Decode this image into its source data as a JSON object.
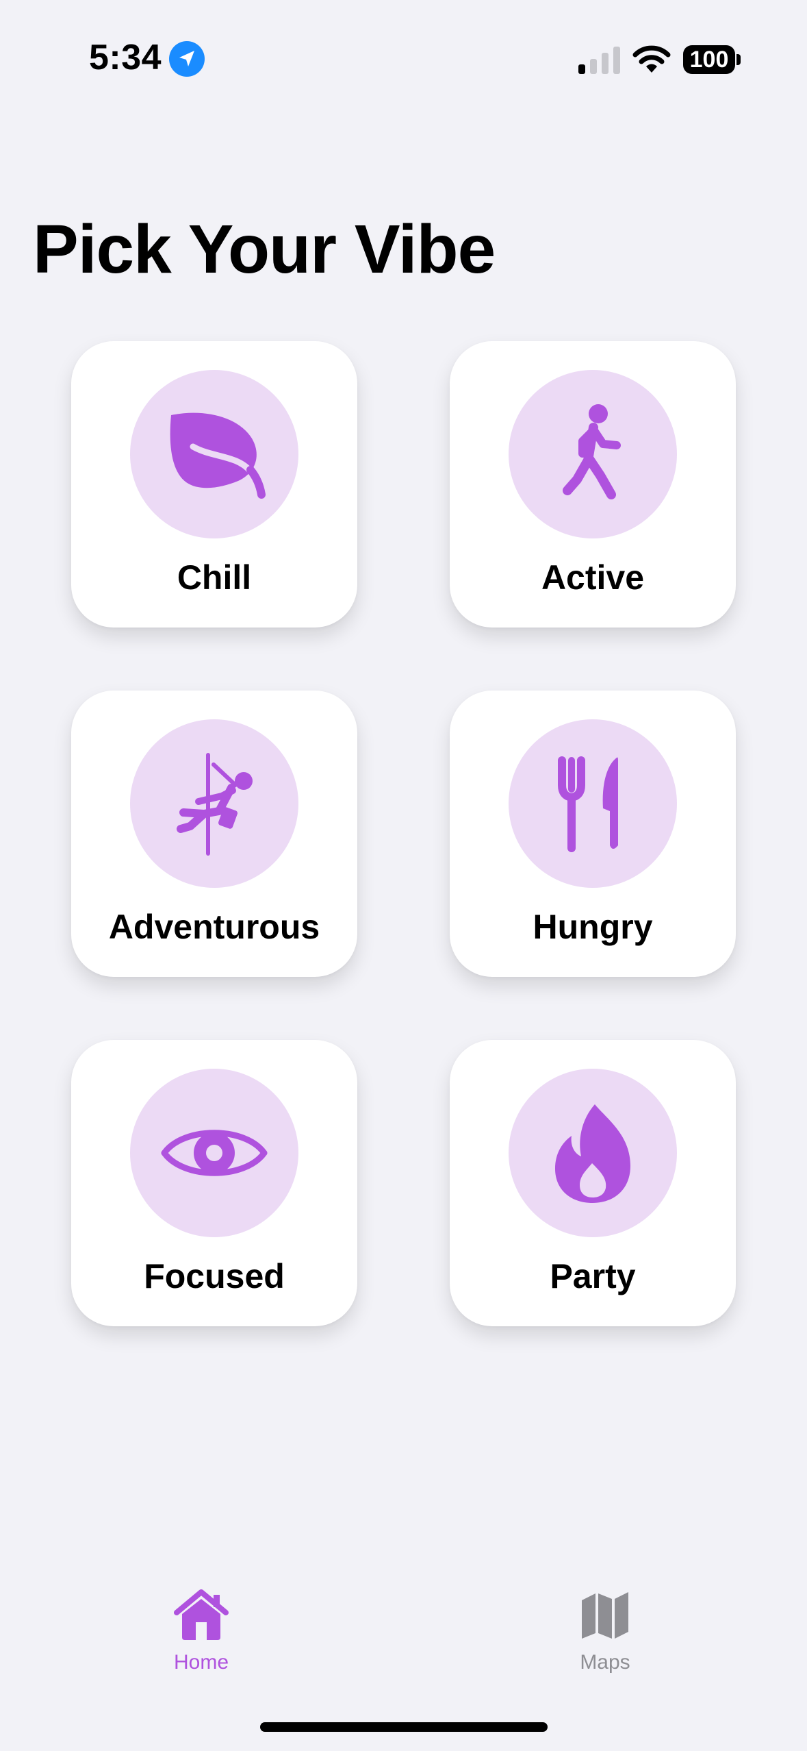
{
  "status_bar": {
    "time": "5:34",
    "battery": "100",
    "location_icon": "location-arrow-icon",
    "signal_icon": "cellular-signal-icon",
    "wifi_icon": "wifi-icon"
  },
  "title": "Pick Your Vibe",
  "colors": {
    "accent": "#af52de",
    "icon_circle": "#ecdaf5",
    "background": "#f2f2f7",
    "card": "#ffffff",
    "inactive_tab": "#8e8e93"
  },
  "vibes": [
    {
      "label": "Chill",
      "icon": "leaf-icon"
    },
    {
      "label": "Active",
      "icon": "walking-person-icon"
    },
    {
      "label": "Adventurous",
      "icon": "climbing-person-icon"
    },
    {
      "label": "Hungry",
      "icon": "fork-knife-icon"
    },
    {
      "label": "Focused",
      "icon": "eye-icon"
    },
    {
      "label": "Party",
      "icon": "flame-icon"
    }
  ],
  "tabs": [
    {
      "label": "Home",
      "icon": "house-icon",
      "selected": true
    },
    {
      "label": "Maps",
      "icon": "map-icon",
      "selected": false
    }
  ]
}
